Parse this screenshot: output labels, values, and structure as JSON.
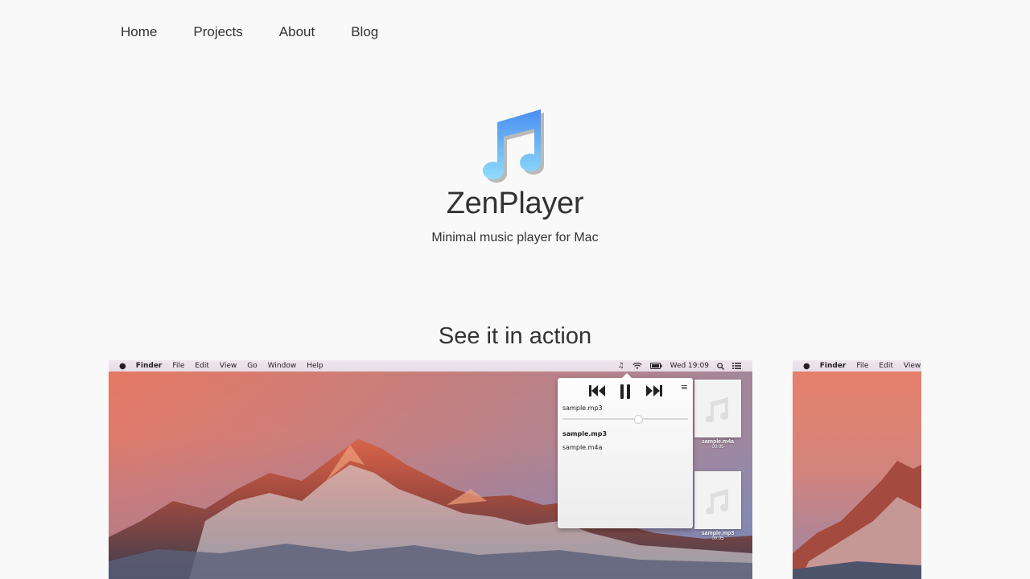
{
  "nav": [
    {
      "label": "Home"
    },
    {
      "label": "Projects"
    },
    {
      "label": "About"
    },
    {
      "label": "Blog"
    }
  ],
  "hero": {
    "icon": "music-note-icon",
    "title": "ZenPlayer",
    "subtitle": "Minimal music player for Mac"
  },
  "section": {
    "title": "See it in action"
  },
  "screenshot_main": {
    "menubar": {
      "apple": "",
      "app": "Finder",
      "items": [
        "File",
        "Edit",
        "View",
        "Go",
        "Window",
        "Help"
      ],
      "clock": "Wed 19:09"
    },
    "player": {
      "now_playing": "sample.mp3",
      "progress": 0.6,
      "playlist": [
        {
          "name": "sample.mp3",
          "active": true
        },
        {
          "name": "sample.m4a",
          "active": false
        }
      ]
    },
    "desktop_files": [
      {
        "name": "sample.m4a",
        "duration": "00:05"
      },
      {
        "name": "sample.mp3",
        "duration": "00:05"
      }
    ]
  },
  "screenshot_side": {
    "menubar": {
      "apple": "",
      "app": "Finder",
      "items": [
        "File",
        "Edit",
        "View"
      ]
    }
  },
  "colors": {
    "page_bg": "#f9f9f9",
    "text": "#333333",
    "icon_blue": "#5ab0f5"
  }
}
